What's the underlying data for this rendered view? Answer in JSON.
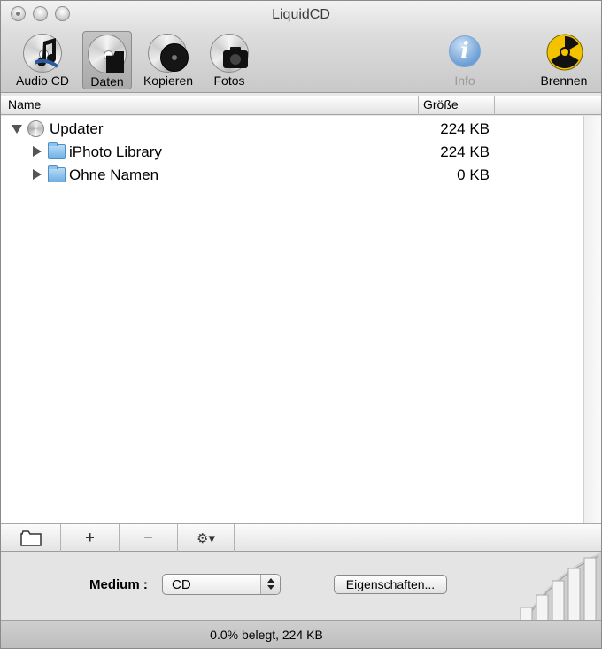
{
  "window": {
    "title": "LiquidCD"
  },
  "toolbar": {
    "items": [
      {
        "label": "Audio CD",
        "icon": "audio-cd-icon"
      },
      {
        "label": "Daten",
        "icon": "data-cd-icon",
        "selected": true
      },
      {
        "label": "Kopieren",
        "icon": "copy-cd-icon"
      },
      {
        "label": "Fotos",
        "icon": "photo-cd-icon"
      },
      {
        "label": "Info",
        "icon": "info-icon",
        "disabled": true
      },
      {
        "label": "Brennen",
        "icon": "burn-icon"
      }
    ]
  },
  "list": {
    "columns": [
      "Name",
      "Größe"
    ],
    "rows": [
      {
        "name": "Updater",
        "size": "224 KB",
        "level": 0,
        "expanded": true,
        "icon": "cd-icon"
      },
      {
        "name": "iPhoto Library",
        "size": "224 KB",
        "level": 1,
        "expanded": false,
        "icon": "folder-icon"
      },
      {
        "name": "Ohne Namen",
        "size": "0 KB",
        "level": 1,
        "expanded": false,
        "icon": "folder-icon"
      }
    ]
  },
  "bottom_bar": {
    "buttons": [
      {
        "name": "new-folder-button",
        "glyph": "folder-icon"
      },
      {
        "name": "add-button",
        "glyph": "+"
      },
      {
        "name": "remove-button",
        "glyph": "−"
      },
      {
        "name": "action-button",
        "glyph": "⚙▾"
      }
    ]
  },
  "medium": {
    "label": "Medium :",
    "selected": "CD"
  },
  "properties_button": "Eigenschaften...",
  "status": "0.0% belegt, 224 KB",
  "meter_level": 0.0,
  "colors": {
    "accent_folder": "#6fb0e4",
    "burn_yellow": "#f3c300",
    "info_blue": "#6b9fd6"
  }
}
